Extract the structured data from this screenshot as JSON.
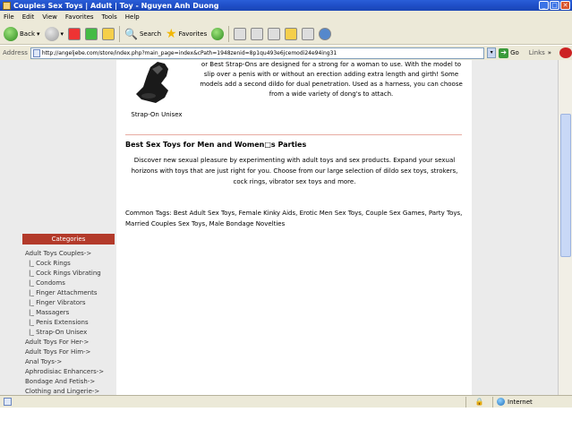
{
  "window": {
    "title": "Couples Sex Toys | Adult | Toy - Nguyen Anh Duong"
  },
  "menu": [
    "File",
    "Edit",
    "View",
    "Favorites",
    "Tools",
    "Help"
  ],
  "toolbar": {
    "back_label": "Back",
    "search_label": "Search",
    "favorites_label": "Favorites"
  },
  "address": {
    "label": "Address",
    "url": "http://angeljebe.com/store/index.php?main_page=index&cPath=1948zenid=8p1qu493e6jcemodi24e94ing31",
    "go_label": "Go",
    "links_label": "Links"
  },
  "product": {
    "description": "or Best Strap-Ons are designed for a strong for a woman to use. With the model to slip over a penis with or without an erection adding extra length and girth! Some models add a second dildo for dual penetration. Used as a harness, you can choose from a wide variety of dong's to attach.",
    "caption": "Strap-On Unisex"
  },
  "section": {
    "title": "Best Sex Toys for Men and Women□s Parties",
    "body": "Discover new sexual pleasure by experimenting with adult toys and sex products. Expand your sexual horizons with toys that are just right for you. Choose from our large selection of dildo sex toys, strokers, cock rings, vibrator sex toys and more."
  },
  "tags": "Common Tags: Best Adult Sex Toys, Female Kinky Aids, Erotic Men Sex Toys, Couple Sex Games, Party Toys, Married Couples Sex Toys, Male Bondage Novelties",
  "categories": {
    "header": "Categories",
    "items": [
      {
        "label": "Adult Toys Couples->",
        "sub": false
      },
      {
        "label": "|_ Cock Rings",
        "sub": true
      },
      {
        "label": "|_ Cock Rings Vibrating",
        "sub": true
      },
      {
        "label": "|_ Condoms",
        "sub": true
      },
      {
        "label": "|_ Finger Attachments",
        "sub": true
      },
      {
        "label": "|_ Finger Vibrators",
        "sub": true
      },
      {
        "label": "|_ Massagers",
        "sub": true
      },
      {
        "label": "|_ Penis Extensions",
        "sub": true
      },
      {
        "label": "|_ Strap-On Unisex",
        "sub": true
      },
      {
        "label": "Adult Toys For Her->",
        "sub": false
      },
      {
        "label": "Adult Toys For Him->",
        "sub": false
      },
      {
        "label": "Anal Toys->",
        "sub": false
      },
      {
        "label": "Aphrodisiac Enhancers->",
        "sub": false
      },
      {
        "label": "Bondage And Fetish->",
        "sub": false
      },
      {
        "label": "Clothing and Lingerie->",
        "sub": false
      }
    ]
  },
  "status": {
    "zone": "Internet"
  }
}
